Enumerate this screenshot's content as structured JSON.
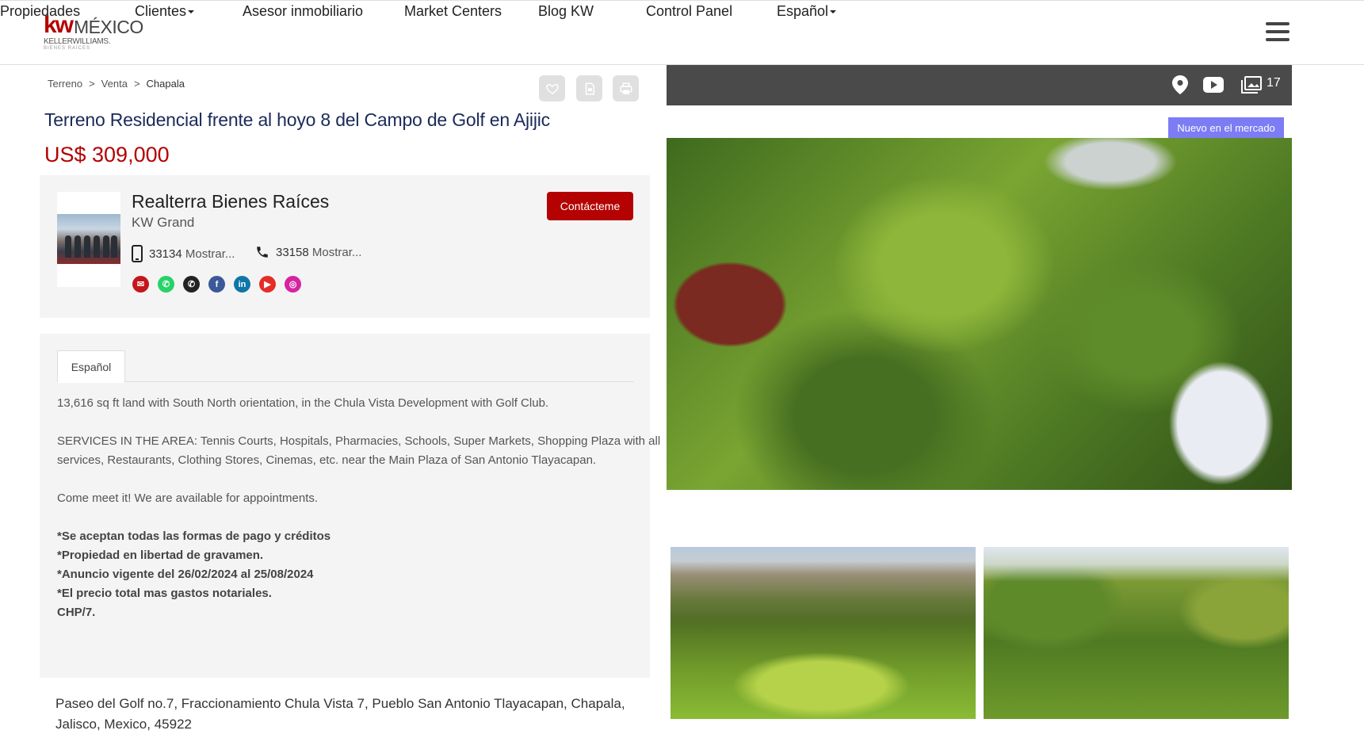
{
  "brand": {
    "logo_mark": "kw",
    "logo_country": "MÉXICO",
    "logo_sub": "KELLERWILLIAMS.",
    "logo_sub2": "BIENES RAÍCES",
    "primary_color": "#b40101",
    "title_color": "#1a2a5a"
  },
  "nav": {
    "items": [
      {
        "label": "Propiedades",
        "has_caret": false
      },
      {
        "label": "Clientes",
        "has_caret": true
      },
      {
        "label": "Asesor inmobiliario",
        "has_caret": false
      },
      {
        "label": "Market Centers",
        "has_caret": false
      },
      {
        "label": "Blog KW",
        "has_caret": false
      },
      {
        "label": "Control Panel",
        "has_caret": false
      },
      {
        "label": "Español",
        "has_caret": true
      }
    ],
    "menu_icon": "hamburger-icon"
  },
  "breadcrumb": [
    "Terreno",
    "Venta",
    "Chapala"
  ],
  "breadcrumb_sep": ">",
  "toolbar": {
    "favorite_icon": "heart-icon",
    "pdf_icon": "document-icon",
    "print_icon": "printer-icon"
  },
  "listing": {
    "title": "Terreno Residencial frente al hoyo 8 del Campo de Golf en Ajijic",
    "price": "US$ 309,000",
    "address": "Paseo del Golf no.7, Fraccionamiento Chula Vista 7, Pueblo San Antonio Tlayacapan, Chapala, Jalisco, Mexico, 45922"
  },
  "agent": {
    "name": "Realterra Bienes Raíces",
    "office": "KW Grand",
    "mobile_prefix": "33134",
    "mobile_more": "Mostrar...",
    "phone_prefix": "33158",
    "phone_more": "Mostrar...",
    "contact_label": "Contácteme",
    "socials": [
      {
        "name": "email-icon",
        "color": "#c4161c",
        "glyph": "✉"
      },
      {
        "name": "whatsapp-icon",
        "color": "#25d366",
        "glyph": "✆"
      },
      {
        "name": "phone-icon",
        "color": "#222222",
        "glyph": "✆"
      },
      {
        "name": "facebook-icon",
        "color": "#3b5998",
        "glyph": "f"
      },
      {
        "name": "linkedin-icon",
        "color": "#0e76a8",
        "glyph": "in"
      },
      {
        "name": "youtube-icon",
        "color": "#e52d27",
        "glyph": "▶"
      },
      {
        "name": "instagram-icon",
        "color": "#d6249f",
        "glyph": "◎"
      }
    ]
  },
  "description": {
    "tab_label": "Español",
    "lines": [
      {
        "text": "13,616 sq ft  land with South North orientation, in the Chula Vista Development with Golf Club.",
        "bold": false
      },
      {
        "text": "",
        "bold": false
      },
      {
        "text": "SERVICES IN THE AREA: Tennis Courts, Hospitals, Pharmacies, Schools, Super Markets, Shopping Plaza with all",
        "bold": false
      },
      {
        "text": "services, Restaurants, Clothing Stores, Cinemas, etc. near the Main Plaza of San Antonio Tlayacapan.",
        "bold": false
      },
      {
        "text": "",
        "bold": false
      },
      {
        "text": "Come meet it! We are available for appointments.",
        "bold": false
      },
      {
        "text": "",
        "bold": false
      },
      {
        "text": "*Se aceptan todas las formas de pago y créditos",
        "bold": true
      },
      {
        "text": "*Propiedad en libertad de gravamen.",
        "bold": true
      },
      {
        "text": "*Anuncio vigente del 26/02/2024 al 25/08/2024",
        "bold": true
      },
      {
        "text": "*El precio total mas gastos notariales.",
        "bold": true
      },
      {
        "text": "CHP/7.",
        "bold": true
      }
    ]
  },
  "gallery": {
    "map_icon": "map-pin-icon",
    "video_icon": "youtube-play-icon",
    "photos_icon": "photos-icon",
    "photo_count": "17",
    "badge": "Nuevo en el mercado"
  }
}
